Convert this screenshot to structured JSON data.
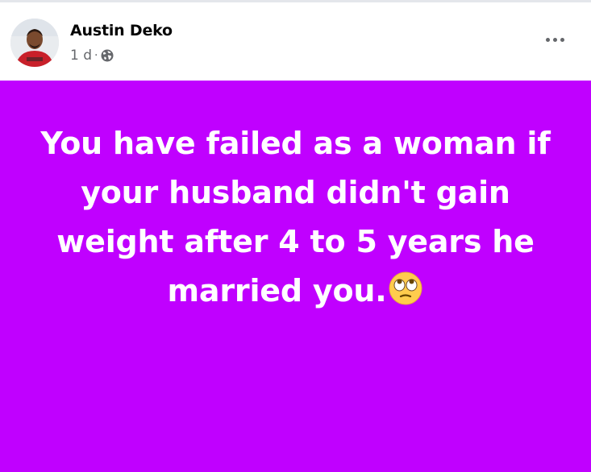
{
  "post": {
    "author": "Austin Deko",
    "time": "1 d",
    "separator": "·",
    "privacy_icon": "globe-icon",
    "more_icon": "more-options-icon",
    "background_color": "#c000ff",
    "text_lines": [
      "You have failed as a woman if",
      "your husband didn't gain",
      "weight after 4 to 5 years he",
      "married you."
    ],
    "emoji": "face-with-rolling-eyes"
  }
}
